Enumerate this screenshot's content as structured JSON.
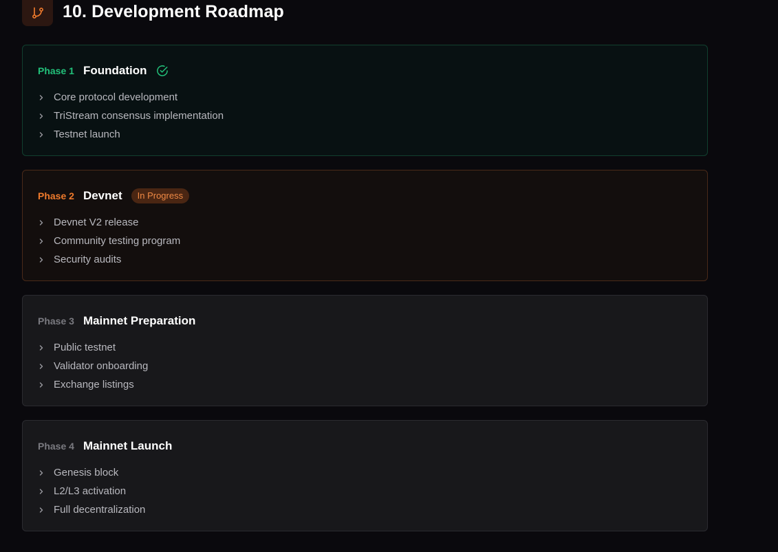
{
  "header": {
    "icon": "git-branch-icon",
    "title": "10. Development Roadmap",
    "accent_color": "#ef7a2c"
  },
  "phases": [
    {
      "number_label": "Phase 1",
      "title": "Foundation",
      "status": "complete",
      "status_icon": "check-circle-icon",
      "color": "#22c17a",
      "items": [
        "Core protocol development",
        "TriStream consensus implementation",
        "Testnet launch"
      ]
    },
    {
      "number_label": "Phase 2",
      "title": "Devnet",
      "status": "in-progress",
      "badge": "In Progress",
      "color": "#ef7a2c",
      "items": [
        "Devnet V2 release",
        "Community testing program",
        "Security audits"
      ]
    },
    {
      "number_label": "Phase 3",
      "title": "Mainnet Preparation",
      "status": "pending",
      "color": "#7a7a80",
      "items": [
        "Public testnet",
        "Validator onboarding",
        "Exchange listings"
      ]
    },
    {
      "number_label": "Phase 4",
      "title": "Mainnet Launch",
      "status": "pending",
      "color": "#7a7a80",
      "items": [
        "Genesis block",
        "L2/L3 activation",
        "Full decentralization"
      ]
    }
  ]
}
